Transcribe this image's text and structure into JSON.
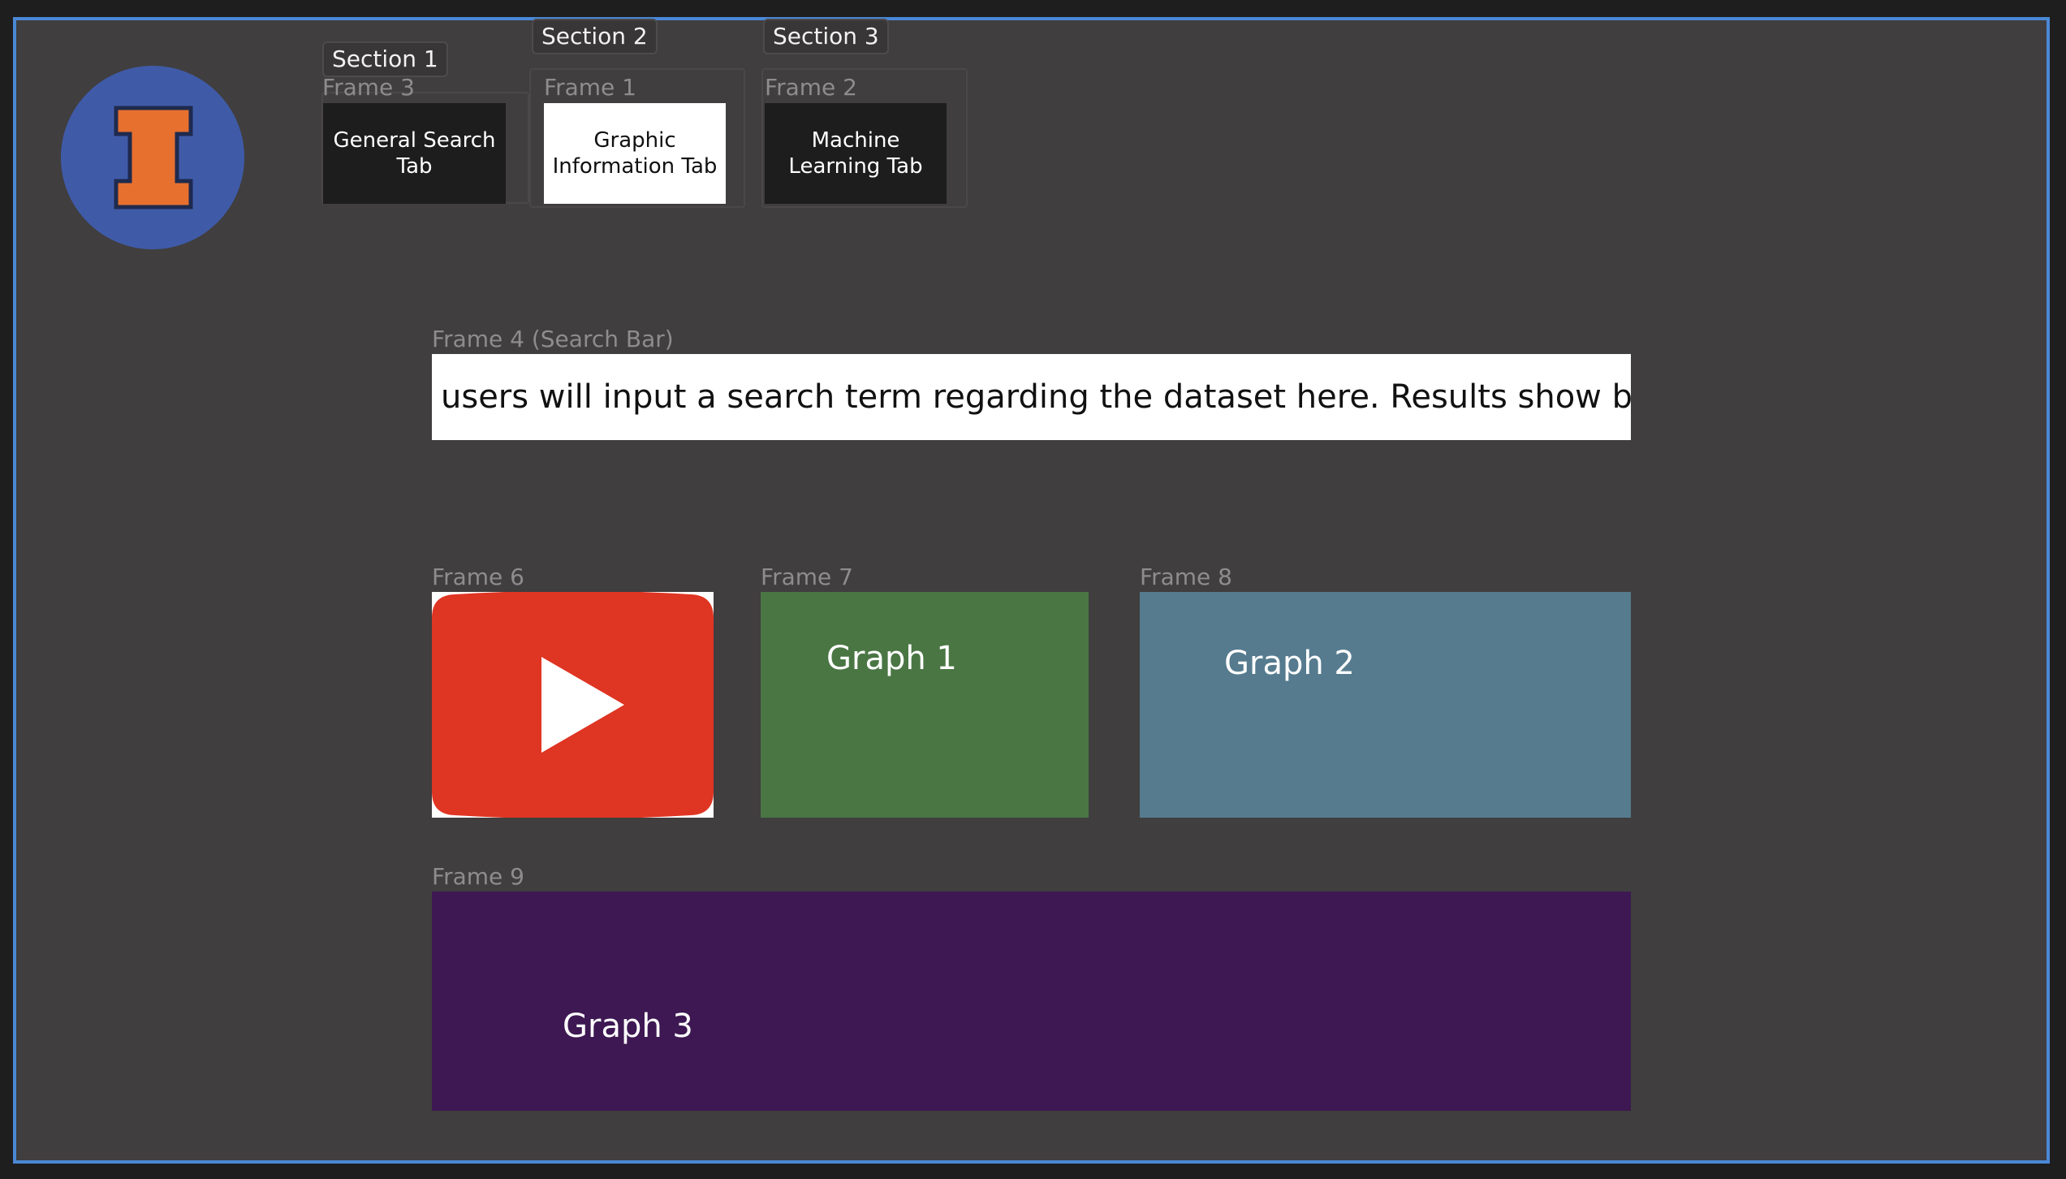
{
  "canvas": {
    "background": "#1e1e1e",
    "board_background": "#403e3f",
    "selection_border": "#4a88d6"
  },
  "logo": {
    "icon": "illinois-block-i-logo",
    "circle_color": "#3f5ba8",
    "letter_color": "#e7702e",
    "outline_color": "#1f2a4e"
  },
  "sections": [
    {
      "label": "Section 1",
      "frame_label": "Frame 3",
      "tab_label": "General Search Tab",
      "tab_bg": "#1d1d1d",
      "tab_fg": "#ffffff"
    },
    {
      "label": "Section 2",
      "frame_label": "Frame 1",
      "tab_label": "Graphic Information Tab",
      "tab_bg": "#ffffff",
      "tab_fg": "#111111"
    },
    {
      "label": "Section 3",
      "frame_label": "Frame 2",
      "tab_label": "Machine Learning Tab",
      "tab_bg": "#1d1d1d",
      "tab_fg": "#ffffff"
    }
  ],
  "search": {
    "frame_label": "Frame 4 (Search Bar)",
    "text": "users will input a search term regarding the dataset here. Results show below"
  },
  "media": {
    "frame_label": "Frame 6",
    "icon": "youtube-play-icon",
    "color": "#df3523"
  },
  "graphs": [
    {
      "frame_label": "Frame 7",
      "label": "Graph 1",
      "color": "#4a7644"
    },
    {
      "frame_label": "Frame 8",
      "label": "Graph 2",
      "color": "#567b8f"
    },
    {
      "frame_label": "Frame 9",
      "label": "Graph 3",
      "color": "#3d1852"
    }
  ]
}
